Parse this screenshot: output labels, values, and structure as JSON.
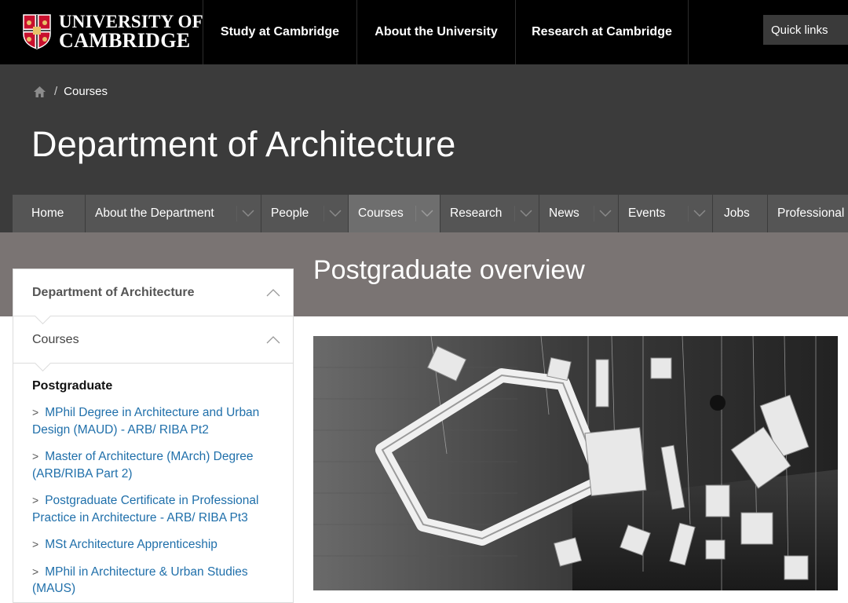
{
  "brand": {
    "line1": "UNIVERSITY OF",
    "line2": "CAMBRIDGE",
    "colors": {
      "crest_red": "#c8102e",
      "crest_gold": "#e8c169"
    }
  },
  "top_nav": [
    {
      "label": "Study at Cambridge"
    },
    {
      "label": "About the University"
    },
    {
      "label": "Research at Cambridge"
    }
  ],
  "quick_links": "Quick links",
  "breadcrumb": {
    "icon": "home-icon",
    "separator": "/",
    "current": "Courses"
  },
  "department_title": "Department of Architecture",
  "dept_nav": [
    {
      "label": "Home"
    },
    {
      "label": "About the Department"
    },
    {
      "label": "People"
    },
    {
      "label": "Courses"
    },
    {
      "label": "Research"
    },
    {
      "label": "News"
    },
    {
      "label": "Events"
    },
    {
      "label": "Jobs"
    },
    {
      "label": "Professional"
    }
  ],
  "page_title": "Postgraduate overview",
  "sidebar": {
    "level1": "Department of Architecture",
    "level2": "Courses",
    "section": "Postgraduate",
    "links": [
      "MPhil Degree in Architecture and Urban Design (MAUD) - ARB/ RIBA Pt2",
      "Master of Architecture (MArch) Degree (ARB/RIBA Part 2)",
      "Postgraduate Certificate in Professional Practice in Architecture - ARB/ RIBA Pt3",
      "MSt Architecture Apprenticeship",
      "MPhil in Architecture & Urban Studies (MAUS)"
    ]
  },
  "colors": {
    "link": "#1f6faa",
    "header_bg": "#3b3b3b",
    "nav_bg": "#555555",
    "band_bg": "#7a7473"
  }
}
